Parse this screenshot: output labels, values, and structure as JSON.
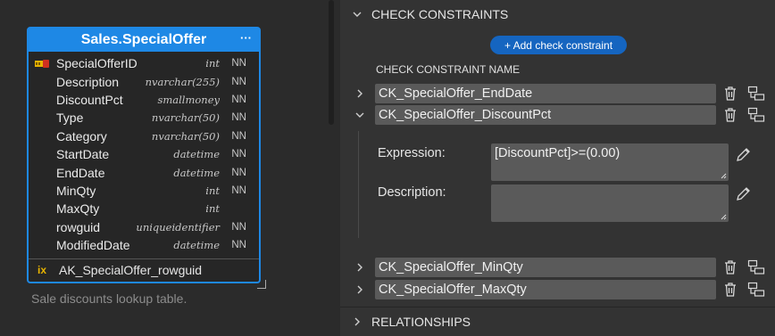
{
  "table": {
    "title": "Sales.SpecialOffer",
    "more_icon": "ellipsis-icon",
    "columns": [
      {
        "name": "SpecialOfferID",
        "type": "int",
        "nn": "NN",
        "pk": true
      },
      {
        "name": "Description",
        "type": "nvarchar(255)",
        "nn": "NN"
      },
      {
        "name": "DiscountPct",
        "type": "smallmoney",
        "nn": "NN"
      },
      {
        "name": "Type",
        "type": "nvarchar(50)",
        "nn": "NN"
      },
      {
        "name": "Category",
        "type": "nvarchar(50)",
        "nn": "NN"
      },
      {
        "name": "StartDate",
        "type": "datetime",
        "nn": "NN"
      },
      {
        "name": "EndDate",
        "type": "datetime",
        "nn": "NN"
      },
      {
        "name": "MinQty",
        "type": "int",
        "nn": "NN"
      },
      {
        "name": "MaxQty",
        "type": "int",
        "nn": ""
      },
      {
        "name": "rowguid",
        "type": "uniqueidentifier",
        "nn": "NN"
      },
      {
        "name": "ModifiedDate",
        "type": "datetime",
        "nn": "NN"
      }
    ],
    "index": {
      "badge": "ix",
      "name": "AK_SpecialOffer_rowguid"
    },
    "description": "Sale discounts lookup table."
  },
  "panel": {
    "check_section": {
      "title": "CHECK CONSTRAINTS",
      "expanded": true
    },
    "add_button": "+ Add check constraint",
    "name_header": "CHECK CONSTRAINT NAME",
    "constraints": [
      {
        "name": "CK_SpecialOffer_EndDate",
        "expanded": false
      },
      {
        "name": "CK_SpecialOffer_DiscountPct",
        "expanded": true
      },
      {
        "name": "CK_SpecialOffer_MinQty",
        "expanded": false
      },
      {
        "name": "CK_SpecialOffer_MaxQty",
        "expanded": false
      }
    ],
    "detail": {
      "expression_label": "Expression:",
      "expression_value": "[DiscountPct]>=(0.00)",
      "description_label": "Description:",
      "description_value": ""
    },
    "relationships_section": {
      "title": "RELATIONSHIPS",
      "expanded": false
    }
  },
  "colors": {
    "accent": "#1e88e5",
    "button": "#1565c0",
    "key": "#e8b400"
  }
}
